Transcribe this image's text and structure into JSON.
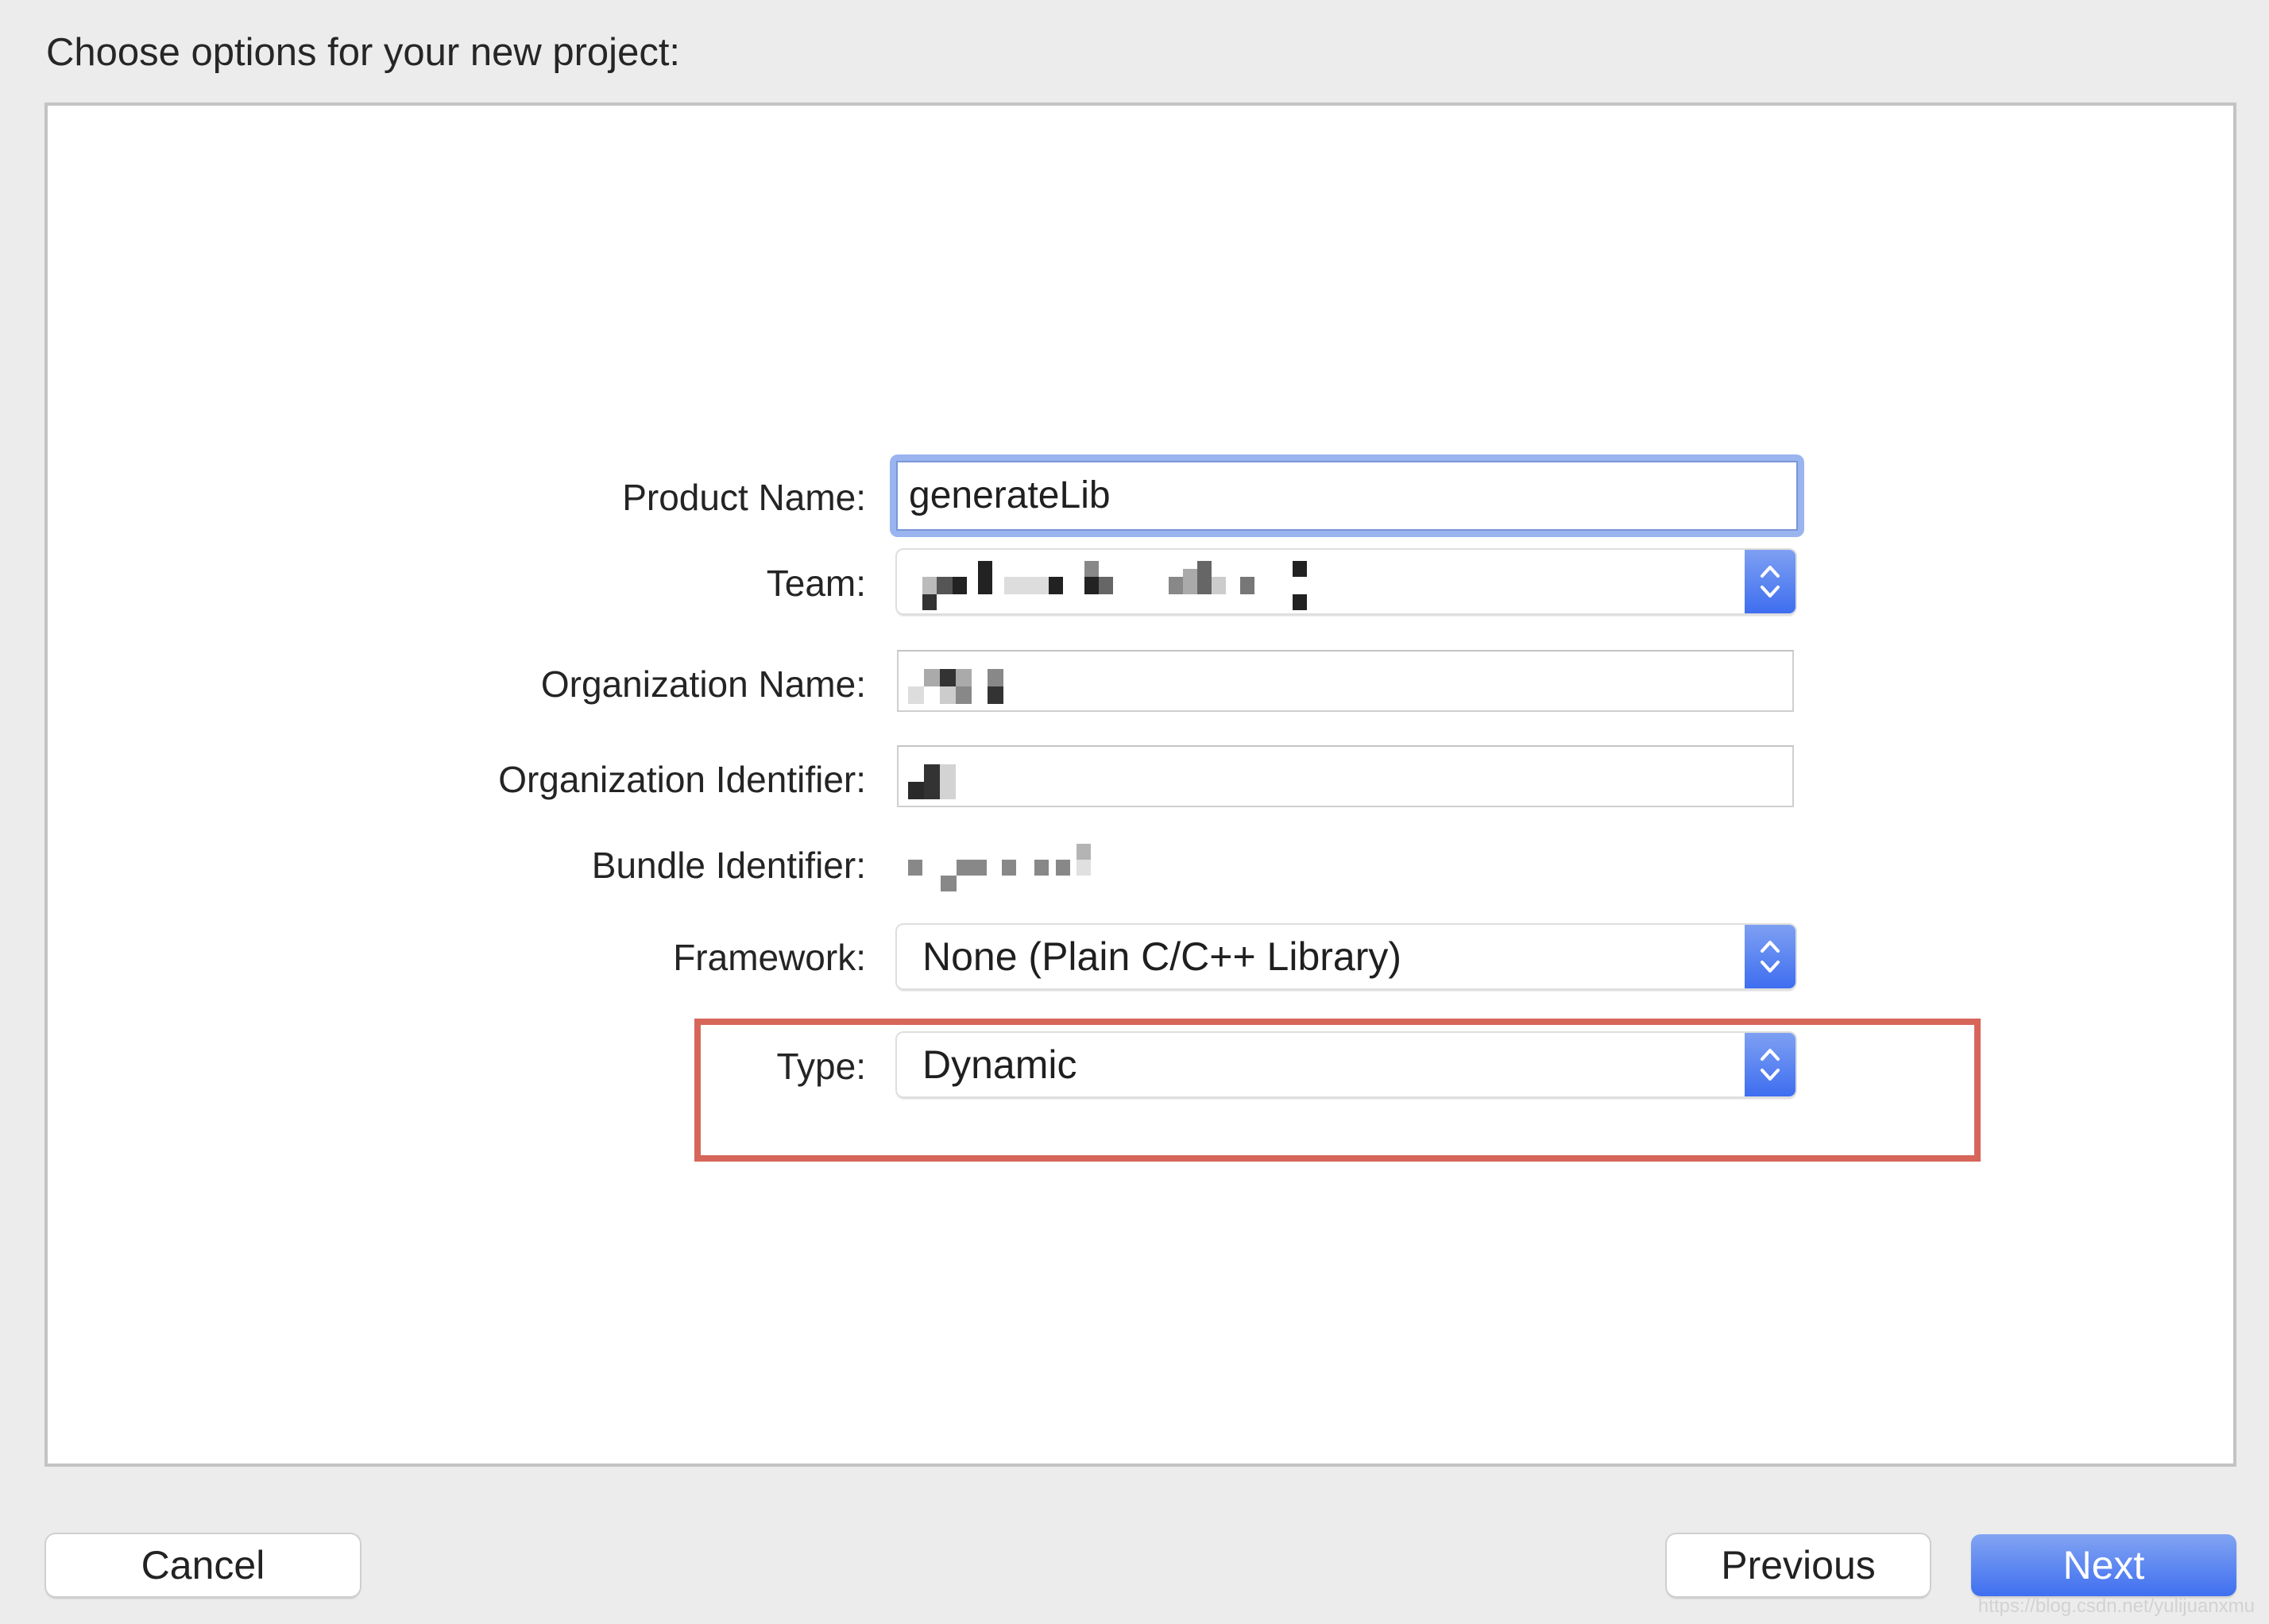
{
  "dialog": {
    "title": "Choose options for your new project:"
  },
  "form": {
    "product_name": {
      "label": "Product Name:",
      "value": "generateLib"
    },
    "team": {
      "label": "Team:",
      "value_redacted": true
    },
    "organization_name": {
      "label": "Organization Name:",
      "value_redacted": true
    },
    "organization_identifier": {
      "label": "Organization Identifier:",
      "value_redacted": true
    },
    "bundle_identifier": {
      "label": "Bundle Identifier:",
      "value_redacted": true
    },
    "framework": {
      "label": "Framework:",
      "selected": "None (Plain C/C++ Library)"
    },
    "type": {
      "label": "Type:",
      "selected": "Dynamic"
    }
  },
  "annotation": {
    "color": "#d6665a",
    "highlights": "type"
  },
  "buttons": {
    "cancel": "Cancel",
    "previous": "Previous",
    "next": "Next"
  },
  "colors": {
    "accent": "#3f6ff0",
    "focus_ring": "#9ab4ef",
    "background": "#ececec"
  },
  "watermark": "https://blog.csdn.net/yulijuanxmu"
}
